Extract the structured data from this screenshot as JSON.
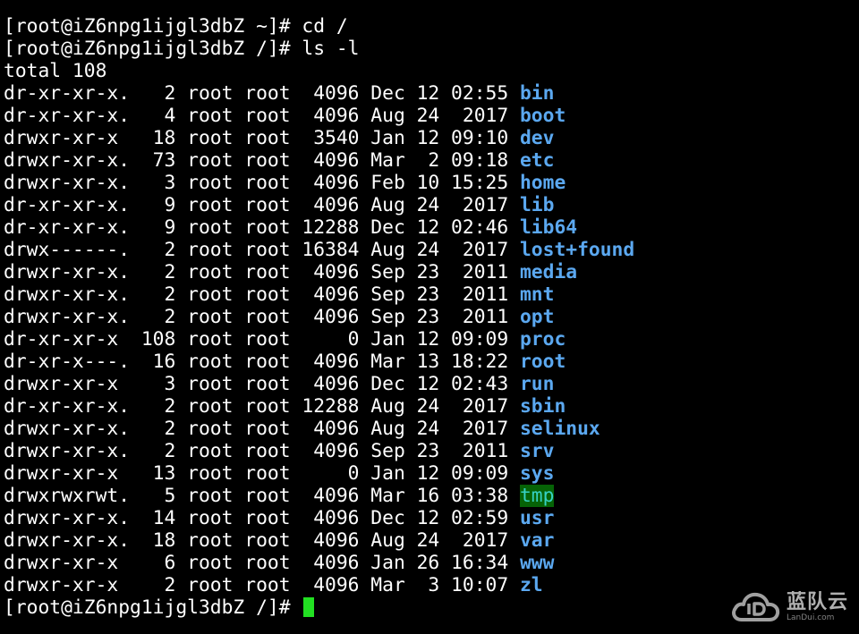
{
  "terminal": {
    "lines": [
      {
        "type": "cmd",
        "prompt": "[root@iZ6npg1ijgl3dbZ ~]# ",
        "command": "cd /"
      },
      {
        "type": "cmd",
        "prompt": "[root@iZ6npg1ijgl3dbZ /]# ",
        "command": "ls -l"
      },
      {
        "type": "text",
        "text": "total 108"
      },
      {
        "type": "entry",
        "meta": "dr-xr-xr-x.   2 root root  4096 Dec 12 02:55 ",
        "name": "bin"
      },
      {
        "type": "entry",
        "meta": "dr-xr-xr-x.   4 root root  4096 Aug 24  2017 ",
        "name": "boot"
      },
      {
        "type": "entry",
        "meta": "drwxr-xr-x   18 root root  3540 Jan 12 09:10 ",
        "name": "dev"
      },
      {
        "type": "entry",
        "meta": "drwxr-xr-x.  73 root root  4096 Mar  2 09:18 ",
        "name": "etc"
      },
      {
        "type": "entry",
        "meta": "drwxr-xr-x.   3 root root  4096 Feb 10 15:25 ",
        "name": "home"
      },
      {
        "type": "entry",
        "meta": "dr-xr-xr-x.   9 root root  4096 Aug 24  2017 ",
        "name": "lib"
      },
      {
        "type": "entry",
        "meta": "dr-xr-xr-x.   9 root root 12288 Dec 12 02:46 ",
        "name": "lib64"
      },
      {
        "type": "entry",
        "meta": "drwx------.   2 root root 16384 Aug 24  2017 ",
        "name": "lost+found"
      },
      {
        "type": "entry",
        "meta": "drwxr-xr-x.   2 root root  4096 Sep 23  2011 ",
        "name": "media"
      },
      {
        "type": "entry",
        "meta": "drwxr-xr-x.   2 root root  4096 Sep 23  2011 ",
        "name": "mnt"
      },
      {
        "type": "entry",
        "meta": "drwxr-xr-x.   2 root root  4096 Sep 23  2011 ",
        "name": "opt"
      },
      {
        "type": "entry",
        "meta": "dr-xr-xr-x  108 root root     0 Jan 12 09:09 ",
        "name": "proc"
      },
      {
        "type": "entry",
        "meta": "dr-xr-x---.  16 root root  4096 Mar 13 18:22 ",
        "name": "root"
      },
      {
        "type": "entry",
        "meta": "drwxr-xr-x    3 root root  4096 Dec 12 02:43 ",
        "name": "run"
      },
      {
        "type": "entry",
        "meta": "dr-xr-xr-x.   2 root root 12288 Aug 24  2017 ",
        "name": "sbin"
      },
      {
        "type": "entry",
        "meta": "drwxr-xr-x.   2 root root  4096 Aug 24  2017 ",
        "name": "selinux"
      },
      {
        "type": "entry",
        "meta": "drwxr-xr-x.   2 root root  4096 Sep 23  2011 ",
        "name": "srv"
      },
      {
        "type": "entry",
        "meta": "drwxr-xr-x   13 root root     0 Jan 12 09:09 ",
        "name": "sys"
      },
      {
        "type": "entry",
        "meta": "drwxrwxrwt.   5 root root  4096 Mar 16 03:38 ",
        "name": "tmp",
        "sticky": true
      },
      {
        "type": "entry",
        "meta": "drwxr-xr-x.  14 root root  4096 Dec 12 02:59 ",
        "name": "usr"
      },
      {
        "type": "entry",
        "meta": "drwxr-xr-x.  18 root root  4096 Aug 24  2017 ",
        "name": "var"
      },
      {
        "type": "entry",
        "meta": "drwxr-xr-x    6 root root  4096 Jan 26 16:34 ",
        "name": "www"
      },
      {
        "type": "entry",
        "meta": "drwxr-xr-x    2 root root  4096 Mar  3 10:07 ",
        "name": "zl"
      },
      {
        "type": "prompt",
        "prompt": "[root@iZ6npg1ijgl3dbZ /]# "
      }
    ]
  },
  "colors": {
    "background": "#000000",
    "text": "#ffffff",
    "directory": "#5ba8f0",
    "sticky_bg": "#066306",
    "cursor": "#22e022"
  },
  "watermark": {
    "icon": "cloud-icon",
    "name": "蓝队云",
    "sub": "LanDui.com"
  }
}
